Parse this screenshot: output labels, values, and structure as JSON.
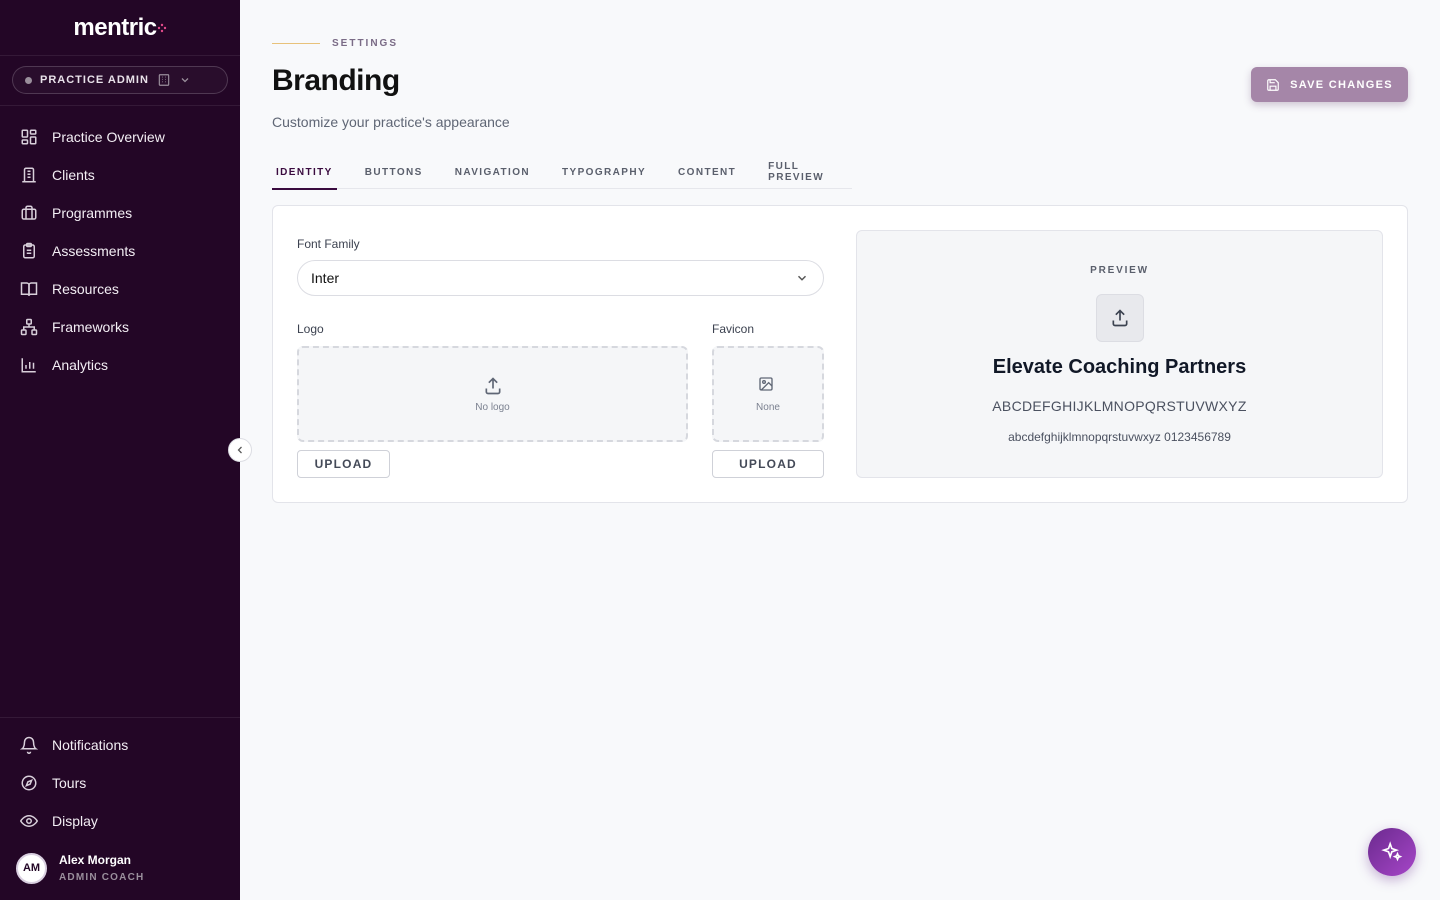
{
  "brand": {
    "name": "mentric",
    "accent": "#e04a8a"
  },
  "role": {
    "label": "PRACTICE ADMIN"
  },
  "sidebar": {
    "items": [
      {
        "label": "Practice Overview",
        "icon": "grid-icon"
      },
      {
        "label": "Clients",
        "icon": "building-icon"
      },
      {
        "label": "Programmes",
        "icon": "briefcase-icon"
      },
      {
        "label": "Assessments",
        "icon": "clipboard-icon"
      },
      {
        "label": "Resources",
        "icon": "book-icon"
      },
      {
        "label": "Frameworks",
        "icon": "network-icon"
      },
      {
        "label": "Analytics",
        "icon": "bar-chart-icon"
      }
    ],
    "bottom": [
      {
        "label": "Notifications",
        "icon": "bell-icon"
      },
      {
        "label": "Tours",
        "icon": "compass-icon"
      },
      {
        "label": "Display",
        "icon": "eye-icon"
      }
    ]
  },
  "user": {
    "initials": "AM",
    "name": "Alex Morgan",
    "role": "ADMIN COACH"
  },
  "header": {
    "eyebrow": "SETTINGS",
    "title": "Branding",
    "subtitle": "Customize your practice's appearance",
    "save_label": "SAVE CHANGES"
  },
  "tabs": [
    {
      "label": "IDENTITY",
      "active": true
    },
    {
      "label": "BUTTONS"
    },
    {
      "label": "NAVIGATION"
    },
    {
      "label": "TYPOGRAPHY"
    },
    {
      "label": "CONTENT"
    },
    {
      "label": "FULL PREVIEW"
    }
  ],
  "identity": {
    "font_family_label": "Font Family",
    "font_family_value": "Inter",
    "logo_label": "Logo",
    "logo_empty": "No logo",
    "logo_upload": "UPLOAD",
    "favicon_label": "Favicon",
    "favicon_empty": "None",
    "favicon_upload": "UPLOAD"
  },
  "preview": {
    "label": "PREVIEW",
    "practice_name": "Elevate Coaching Partners",
    "uppercase_sample": "ABCDEFGHIJKLMNOPQRSTUVWXYZ",
    "lowercase_sample": "abcdefghijklmnopqrstuvwxyz 0123456789"
  },
  "colors": {
    "sidebar_bg": "#230626",
    "save_button": "#a586a8",
    "tab_active": "#3a0b3f",
    "fab_gradient_start": "#6b2a8e",
    "fab_gradient_end": "#a646c8"
  }
}
